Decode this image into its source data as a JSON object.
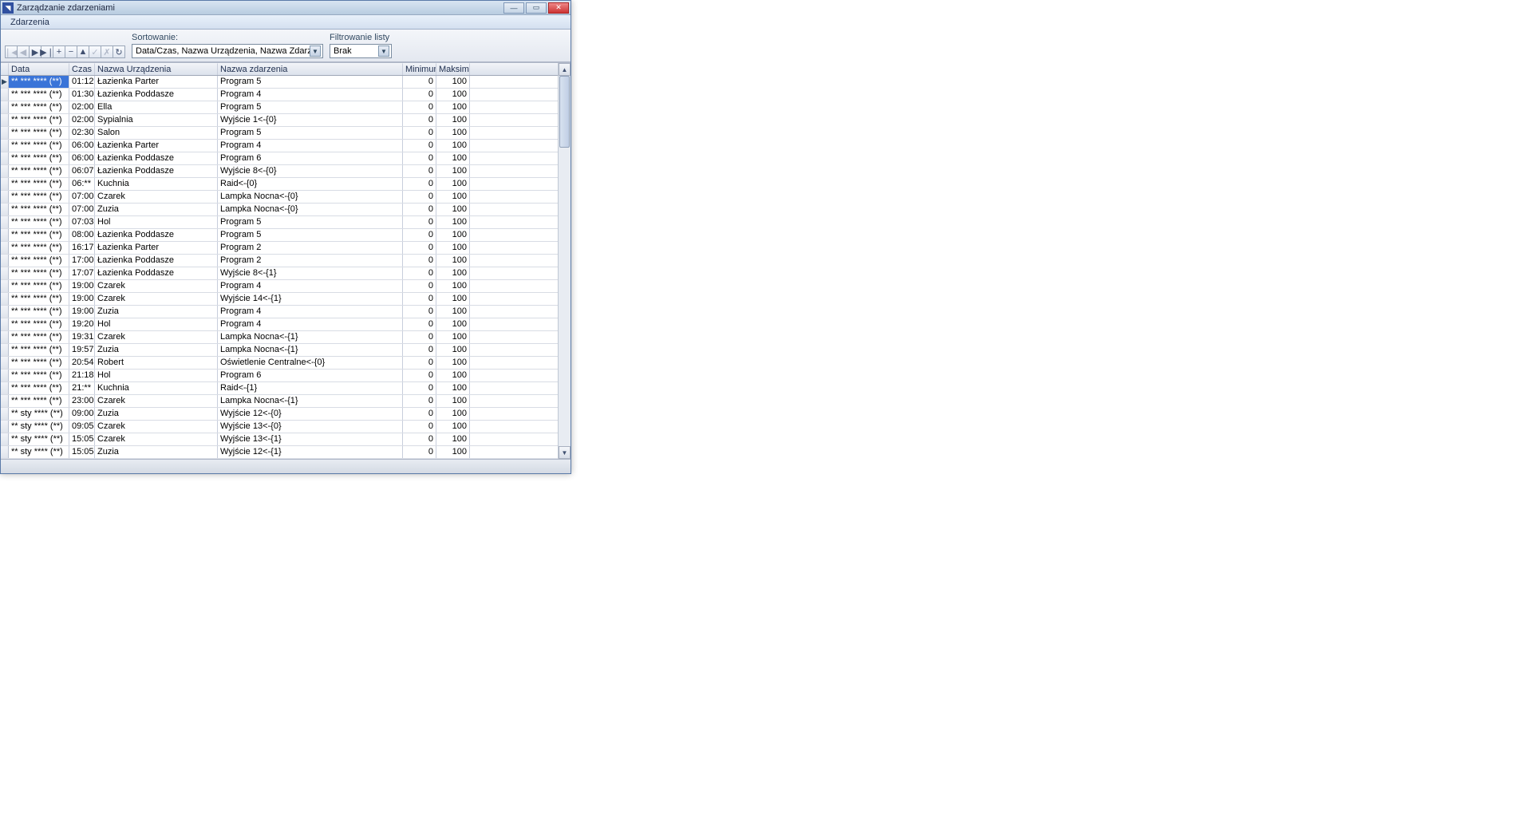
{
  "window": {
    "title": "Zarządzanie zdarzeniami"
  },
  "menu": {
    "item0": "Zdarzenia"
  },
  "toolbar": {
    "sort_label": "Sortowanie:",
    "sort_value": "Data/Czas, Nazwa Urządzenia, Nazwa Zdarzenia (A..Z)",
    "filter_label": "Filtrowanie listy",
    "filter_value": "Brak"
  },
  "nav_icons": {
    "first": "❘◀",
    "prev": "◀",
    "next": "▶",
    "last": "▶❘",
    "add": "+",
    "del": "−",
    "edit": "▲",
    "post": "✓",
    "cancel": "✗",
    "refresh": "↻"
  },
  "headers": {
    "data": "Data",
    "czas": "Czas",
    "dev": "Nazwa Urządzenia",
    "evt": "Nazwa zdarzenia",
    "min": "Minimum",
    "max": "Maksimum"
  },
  "rows": [
    {
      "data": "** *** **** (**)",
      "czas": "01:12",
      "dev": "Łazienka Parter",
      "evt": "Program 5",
      "min": "0",
      "max": "100",
      "sel": true
    },
    {
      "data": "** *** **** (**)",
      "czas": "01:30",
      "dev": "Łazienka Poddasze",
      "evt": "Program 4",
      "min": "0",
      "max": "100"
    },
    {
      "data": "** *** **** (**)",
      "czas": "02:00",
      "dev": "Ella",
      "evt": "Program 5",
      "min": "0",
      "max": "100"
    },
    {
      "data": "** *** **** (**)",
      "czas": "02:00",
      "dev": "Sypialnia",
      "evt": "Wyjście 1<-{0}",
      "min": "0",
      "max": "100"
    },
    {
      "data": "** *** **** (**)",
      "czas": "02:30",
      "dev": "Salon",
      "evt": "Program 5",
      "min": "0",
      "max": "100"
    },
    {
      "data": "** *** **** (**)",
      "czas": "06:00",
      "dev": "Łazienka Parter",
      "evt": "Program 4",
      "min": "0",
      "max": "100"
    },
    {
      "data": "** *** **** (**)",
      "czas": "06:00",
      "dev": "Łazienka Poddasze",
      "evt": "Program 6",
      "min": "0",
      "max": "100"
    },
    {
      "data": "** *** **** (**)",
      "czas": "06:07",
      "dev": "Łazienka Poddasze",
      "evt": "Wyjście 8<-{0}",
      "min": "0",
      "max": "100"
    },
    {
      "data": "** *** **** (**)",
      "czas": "06:**",
      "dev": "Kuchnia",
      "evt": "Raid<-{0}",
      "min": "0",
      "max": "100"
    },
    {
      "data": "** *** **** (**)",
      "czas": "07:00",
      "dev": "Czarek",
      "evt": "Lampka Nocna<-{0}",
      "min": "0",
      "max": "100"
    },
    {
      "data": "** *** **** (**)",
      "czas": "07:00",
      "dev": "Zuzia",
      "evt": "Lampka Nocna<-{0}",
      "min": "0",
      "max": "100"
    },
    {
      "data": "** *** **** (**)",
      "czas": "07:03",
      "dev": "Hol",
      "evt": "Program 5",
      "min": "0",
      "max": "100"
    },
    {
      "data": "** *** **** (**)",
      "czas": "08:00",
      "dev": "Łazienka Poddasze",
      "evt": "Program 5",
      "min": "0",
      "max": "100"
    },
    {
      "data": "** *** **** (**)",
      "czas": "16:17",
      "dev": "Łazienka Parter",
      "evt": "Program 2",
      "min": "0",
      "max": "100"
    },
    {
      "data": "** *** **** (**)",
      "czas": "17:00",
      "dev": "Łazienka Poddasze",
      "evt": "Program 2",
      "min": "0",
      "max": "100"
    },
    {
      "data": "** *** **** (**)",
      "czas": "17:07",
      "dev": "Łazienka Poddasze",
      "evt": "Wyjście 8<-{1}",
      "min": "0",
      "max": "100"
    },
    {
      "data": "** *** **** (**)",
      "czas": "19:00",
      "dev": "Czarek",
      "evt": "Program 4",
      "min": "0",
      "max": "100"
    },
    {
      "data": "** *** **** (**)",
      "czas": "19:00",
      "dev": "Czarek",
      "evt": "Wyjście 14<-{1}",
      "min": "0",
      "max": "100"
    },
    {
      "data": "** *** **** (**)",
      "czas": "19:00",
      "dev": "Zuzia",
      "evt": "Program 4",
      "min": "0",
      "max": "100"
    },
    {
      "data": "** *** **** (**)",
      "czas": "19:20",
      "dev": "Hol",
      "evt": "Program 4",
      "min": "0",
      "max": "100"
    },
    {
      "data": "** *** **** (**)",
      "czas": "19:31",
      "dev": "Czarek",
      "evt": "Lampka Nocna<-{1}",
      "min": "0",
      "max": "100"
    },
    {
      "data": "** *** **** (**)",
      "czas": "19:57",
      "dev": "Zuzia",
      "evt": "Lampka Nocna<-{1}",
      "min": "0",
      "max": "100"
    },
    {
      "data": "** *** **** (**)",
      "czas": "20:54",
      "dev": "Robert",
      "evt": "Oświetlenie Centralne<-{0}",
      "min": "0",
      "max": "100"
    },
    {
      "data": "** *** **** (**)",
      "czas": "21:18",
      "dev": "Hol",
      "evt": "Program 6",
      "min": "0",
      "max": "100"
    },
    {
      "data": "** *** **** (**)",
      "czas": "21:**",
      "dev": "Kuchnia",
      "evt": "Raid<-{1}",
      "min": "0",
      "max": "100"
    },
    {
      "data": "** *** **** (**)",
      "czas": "23:00",
      "dev": "Czarek",
      "evt": "Lampka Nocna<-{1}",
      "min": "0",
      "max": "100"
    },
    {
      "data": "** sty **** (**)",
      "czas": "09:00",
      "dev": "Zuzia",
      "evt": "Wyjście 12<-{0}",
      "min": "0",
      "max": "100"
    },
    {
      "data": "** sty **** (**)",
      "czas": "09:05",
      "dev": "Czarek",
      "evt": "Wyjście 13<-{0}",
      "min": "0",
      "max": "100"
    },
    {
      "data": "** sty **** (**)",
      "czas": "15:05",
      "dev": "Czarek",
      "evt": "Wyjście 13<-{1}",
      "min": "0",
      "max": "100"
    },
    {
      "data": "** sty **** (**)",
      "czas": "15:05",
      "dev": "Zuzia",
      "evt": "Wyjście 12<-{1}",
      "min": "0",
      "max": "100"
    }
  ]
}
